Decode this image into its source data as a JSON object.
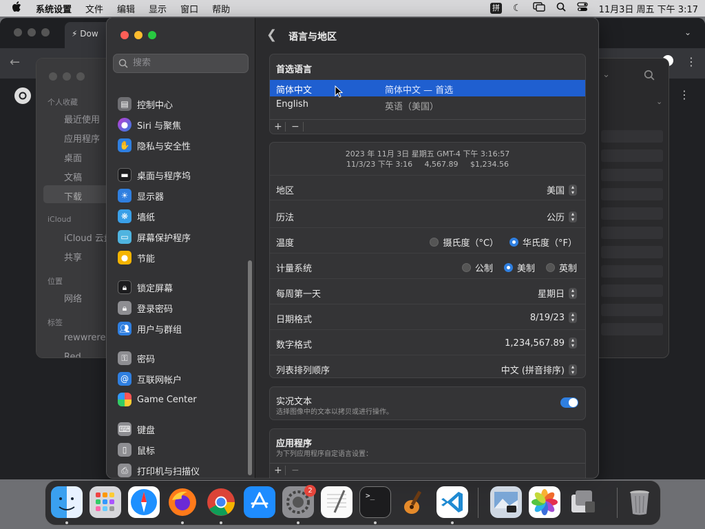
{
  "menubar": {
    "app_name": "系统设置",
    "items": [
      "文件",
      "编辑",
      "显示",
      "窗口",
      "帮助"
    ],
    "input_method": "拼",
    "datetime": "11月3日 周五 下午 3:17"
  },
  "browser": {
    "tab_title": "Dow"
  },
  "finder": {
    "sections": {
      "favorites": "个人收藏",
      "icloud": "iCloud",
      "locations": "位置",
      "tags": "标签"
    },
    "items": {
      "recent": "最近使用",
      "apps": "应用程序",
      "desktop": "桌面",
      "docs": "文稿",
      "downloads": "下载",
      "icloud_drive": "iCloud 云盘",
      "shared": "共享",
      "network": "网络",
      "tag1": "rewwrerer",
      "tag2": "Red"
    }
  },
  "settings": {
    "search_placeholder": "搜索",
    "sidebar": [
      {
        "label": "控制中心",
        "icon": "control-center-icon",
        "color": "#6e6e72"
      },
      {
        "label": "Siri 与聚焦",
        "icon": "siri-icon",
        "color": "#c23bd4"
      },
      {
        "label": "隐私与安全性",
        "icon": "hand-icon",
        "color": "#2f7fe0"
      },
      {
        "label": "桌面与程序坞",
        "icon": "dock-icon",
        "color": "#1c1c1e"
      },
      {
        "label": "显示器",
        "icon": "display-icon",
        "color": "#2f7fe0"
      },
      {
        "label": "墙纸",
        "icon": "wallpaper-icon",
        "color": "#3aa0e8"
      },
      {
        "label": "屏幕保护程序",
        "icon": "screensaver-icon",
        "color": "#4fb4e0"
      },
      {
        "label": "节能",
        "icon": "bulb-icon",
        "color": "#f5b400"
      },
      {
        "label": "锁定屏幕",
        "icon": "lock-icon",
        "color": "#1c1c1e"
      },
      {
        "label": "登录密码",
        "icon": "lock-icon",
        "color": "#8e8e92"
      },
      {
        "label": "用户与群组",
        "icon": "users-icon",
        "color": "#2f7fe0"
      },
      {
        "label": "密码",
        "icon": "key-icon",
        "color": "#8e8e92"
      },
      {
        "label": "互联网帐户",
        "icon": "at-icon",
        "color": "#2f7fe0"
      },
      {
        "label": "Game Center",
        "icon": "game-center-icon",
        "color": "#ffffff"
      },
      {
        "label": "键盘",
        "icon": "keyboard-icon",
        "color": "#8e8e92"
      },
      {
        "label": "鼠标",
        "icon": "mouse-icon",
        "color": "#8e8e92"
      },
      {
        "label": "打印机与扫描仪",
        "icon": "printer-icon",
        "color": "#8e8e92"
      }
    ],
    "page_title": "语言与地区",
    "preferred_languages": {
      "header": "首选语言",
      "languages": [
        {
          "name": "简体中文",
          "desc": "简体中文 — 首选",
          "selected": true
        },
        {
          "name": "English",
          "desc": "英语（美国）",
          "selected": false
        }
      ],
      "add": "+",
      "remove": "−"
    },
    "format_preview": {
      "line1": "2023 年 11月 3日 星期五 GMT-4 下午 3:16:57",
      "line2": "11/3/23 下午 3:16     4,567.89     $1,234.56"
    },
    "rows": {
      "region": {
        "label": "地区",
        "value": "美国"
      },
      "calendar": {
        "label": "历法",
        "value": "公历"
      },
      "temperature": {
        "label": "温度",
        "celsius": "摄氏度（°C）",
        "fahrenheit": "华氏度（°F）",
        "selected": "fahrenheit"
      },
      "measurement": {
        "label": "计量系统",
        "metric": "公制",
        "us": "美制",
        "uk": "英制",
        "selected": "us"
      },
      "first_day": {
        "label": "每周第一天",
        "value": "星期日"
      },
      "date_format": {
        "label": "日期格式",
        "value": "8/19/23"
      },
      "number_format": {
        "label": "数字格式",
        "value": "1,234,567.89"
      },
      "list_sort": {
        "label": "列表排列顺序",
        "value": "中文 (拼音排序)"
      }
    },
    "live_text": {
      "title": "实况文本",
      "desc": "选择图像中的文本以拷贝或进行操作。",
      "enabled": true
    },
    "applications": {
      "title": "应用程序",
      "desc": "为下列应用程序自定语言设置："
    }
  },
  "dock": {
    "apps": [
      "Finder",
      "Launchpad",
      "Safari",
      "Firefox",
      "Chrome",
      "App Store",
      "System Settings",
      "TextEdit",
      "Terminal",
      "GarageBand",
      "Visual Studio Code",
      "Preview",
      "Photos",
      "Migration Assistant",
      "Trash"
    ],
    "settings_badge": "2"
  },
  "colors": {
    "accent": "#2f7fe0",
    "selected_row": "#1f5fd0"
  }
}
